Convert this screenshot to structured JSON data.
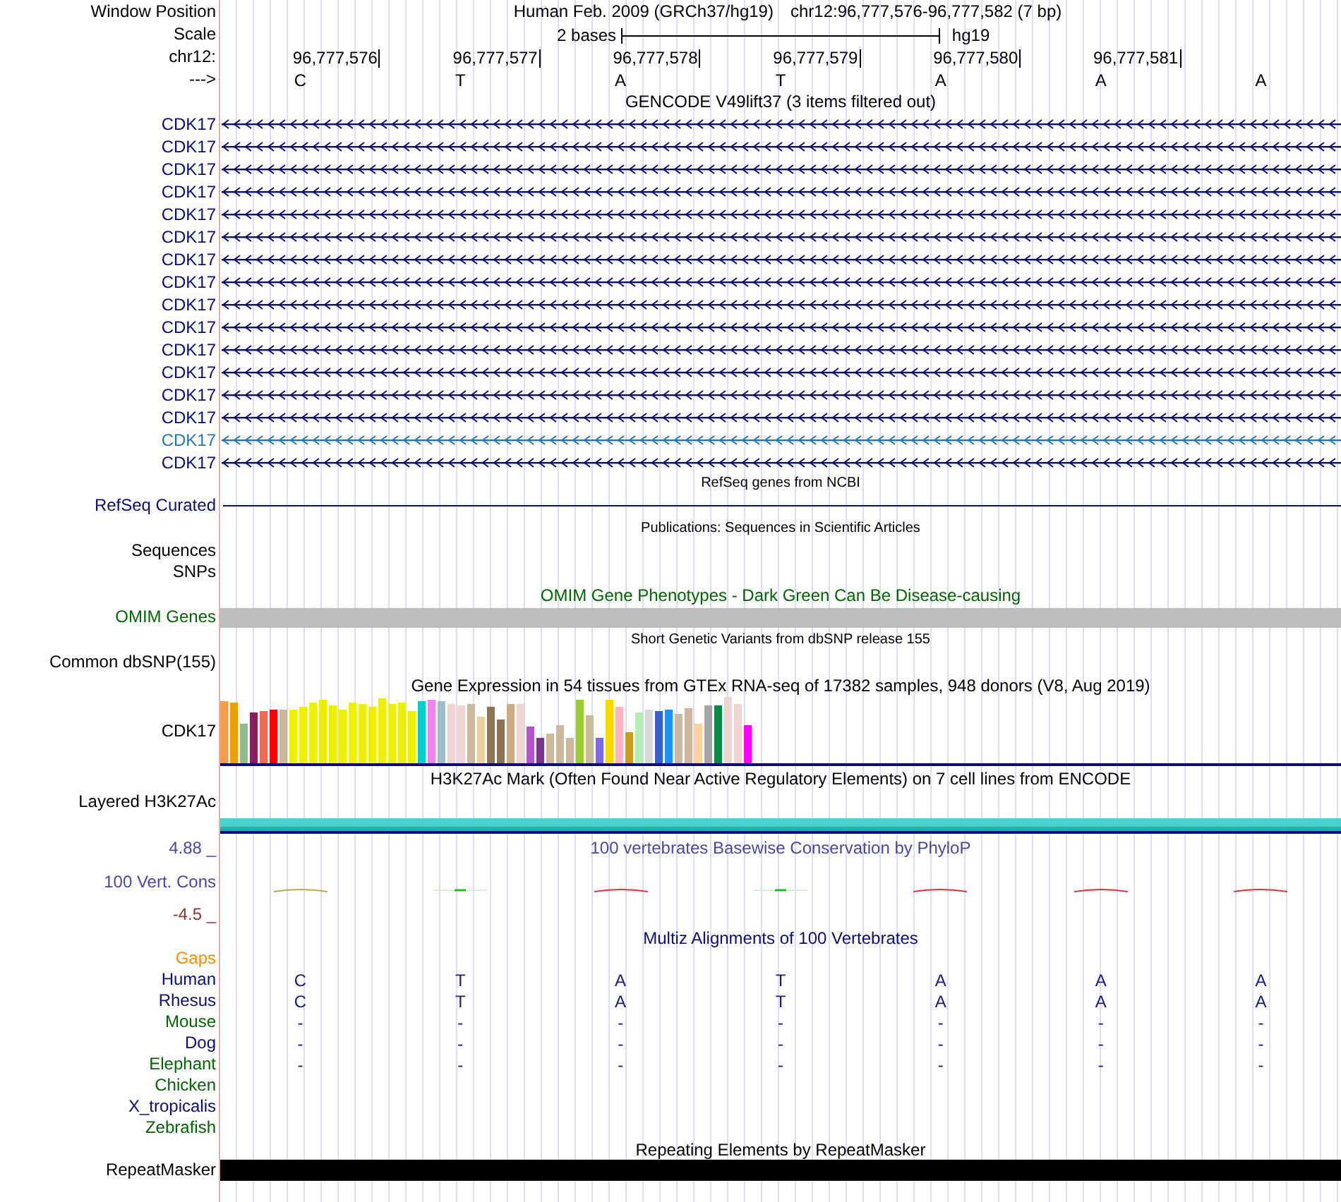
{
  "header": {
    "label": "Window Position",
    "title": "Human Feb. 2009 (GRCh37/hg19)",
    "position": "chr12:96,777,576-96,777,582 (7 bp)"
  },
  "scale": {
    "label": "Scale",
    "text": "2 bases",
    "assembly": "hg19"
  },
  "ruler": {
    "label": "chr12:",
    "positions": [
      "96,777,576",
      "96,777,577",
      "96,777,578",
      "96,777,579",
      "96,777,580",
      "96,777,581"
    ]
  },
  "strand": {
    "label": "--->",
    "bases": [
      "C",
      "T",
      "A",
      "T",
      "A",
      "A",
      "A"
    ]
  },
  "tracks": [
    {
      "kind": "genes",
      "title": "GENCODE V49lift37 (3 items filtered out)",
      "items": [
        {
          "label": "CDK17",
          "color": "#0c0c78"
        },
        {
          "label": "CDK17",
          "color": "#0c0c78"
        },
        {
          "label": "CDK17",
          "color": "#0c0c78"
        },
        {
          "label": "CDK17",
          "color": "#0c0c78"
        },
        {
          "label": "CDK17",
          "color": "#0c0c78"
        },
        {
          "label": "CDK17",
          "color": "#0c0c78"
        },
        {
          "label": "CDK17",
          "color": "#0c0c78"
        },
        {
          "label": "CDK17",
          "color": "#0c0c78"
        },
        {
          "label": "CDK17",
          "color": "#0c0c78"
        },
        {
          "label": "CDK17",
          "color": "#0c0c78"
        },
        {
          "label": "CDK17",
          "color": "#0c0c78"
        },
        {
          "label": "CDK17",
          "color": "#0c0c78"
        },
        {
          "label": "CDK17",
          "color": "#0c0c78"
        },
        {
          "label": "CDK17",
          "color": "#0c0c78"
        },
        {
          "label": "CDK17",
          "color": "#1f78b4"
        },
        {
          "label": "CDK17",
          "color": "#0c0c78"
        }
      ]
    },
    {
      "kind": "line",
      "title": "RefSeq genes from NCBI",
      "label": "RefSeq Curated"
    },
    {
      "kind": "labels",
      "title": "Publications: Sequences in Scientific Articles",
      "labels": [
        "Sequences",
        "SNPs"
      ]
    },
    {
      "kind": "omim",
      "title": "OMIM Gene Phenotypes - Dark Green Can Be Disease-causing",
      "label": "OMIM Genes"
    },
    {
      "kind": "labels",
      "title": "Short Genetic Variants from dbSNP release 155",
      "labels": [
        "Common dbSNP(155)"
      ]
    },
    {
      "kind": "gtex",
      "title": "Gene Expression in 54 tissues from GTEx RNA-seq of 17382 samples, 948 donors (V8, Aug 2019)",
      "label": "CDK17"
    },
    {
      "kind": "layered",
      "title": "H3K27Ac Mark (Often Found Near Active Regulatory Elements) on 7 cell lines from ENCODE",
      "label": "Layered H3K27Ac"
    },
    {
      "kind": "wiggle",
      "title": "100 vertebrates Basewise Conservation by PhyloP",
      "label": "100 Vert. Cons",
      "max": "4.88 _",
      "min": "-4.5 _"
    },
    {
      "kind": "alignment",
      "title": "Multiz Alignments of 100 Vertebrates",
      "rows": [
        {
          "label": "Gaps",
          "color": "#ff8c00"
        },
        {
          "label": "Human",
          "color": "#0c0c78",
          "bases": [
            "C",
            "T",
            "A",
            "T",
            "A",
            "A",
            "A"
          ]
        },
        {
          "label": "Rhesus",
          "color": "#0c0c78",
          "bases": [
            "C",
            "T",
            "A",
            "T",
            "A",
            "A",
            "A"
          ]
        },
        {
          "label": "Mouse",
          "color": "#006400",
          "bases": [
            "-",
            "-",
            "-",
            "-",
            "-",
            "-",
            "-"
          ]
        },
        {
          "label": "Dog",
          "color": "#0c0c78",
          "bases": [
            "-",
            "-",
            "-",
            "-",
            "-",
            "-",
            "-"
          ]
        },
        {
          "label": "Elephant",
          "color": "#006400",
          "bases": [
            "-",
            "-",
            "-",
            "-",
            "-",
            "-",
            "-"
          ]
        },
        {
          "label": "Chicken",
          "color": "#006400"
        },
        {
          "label": "X_tropicalis",
          "color": "#0c0c78"
        },
        {
          "label": "Zebrafish",
          "color": "#006400"
        }
      ]
    },
    {
      "kind": "repeats",
      "title": "Repeating Elements by RepeatMasker",
      "label": "RepeatMasker"
    }
  ]
}
